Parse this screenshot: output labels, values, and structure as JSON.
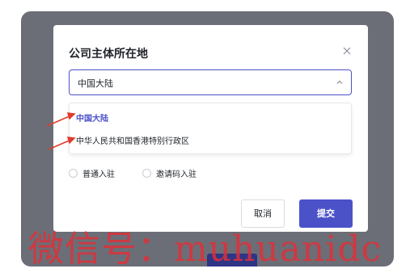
{
  "modal": {
    "title": "公司主体所在地",
    "select_value": "中国大陆",
    "options": [
      "中国大陆",
      "中华人民共和国香港特别行政区"
    ],
    "radio_options": [
      "普通入驻",
      "邀请码入驻"
    ],
    "cancel_label": "取消",
    "submit_label": "提交"
  },
  "watermark": "微信号：muhuanidc",
  "colors": {
    "accent": "#4b52c8",
    "backdrop": "#6b6e76",
    "arrow": "#e03a2c",
    "watermark": "#e0303a"
  },
  "icons": {
    "close": "close-icon",
    "select_arrow": "chevron-up-icon"
  }
}
